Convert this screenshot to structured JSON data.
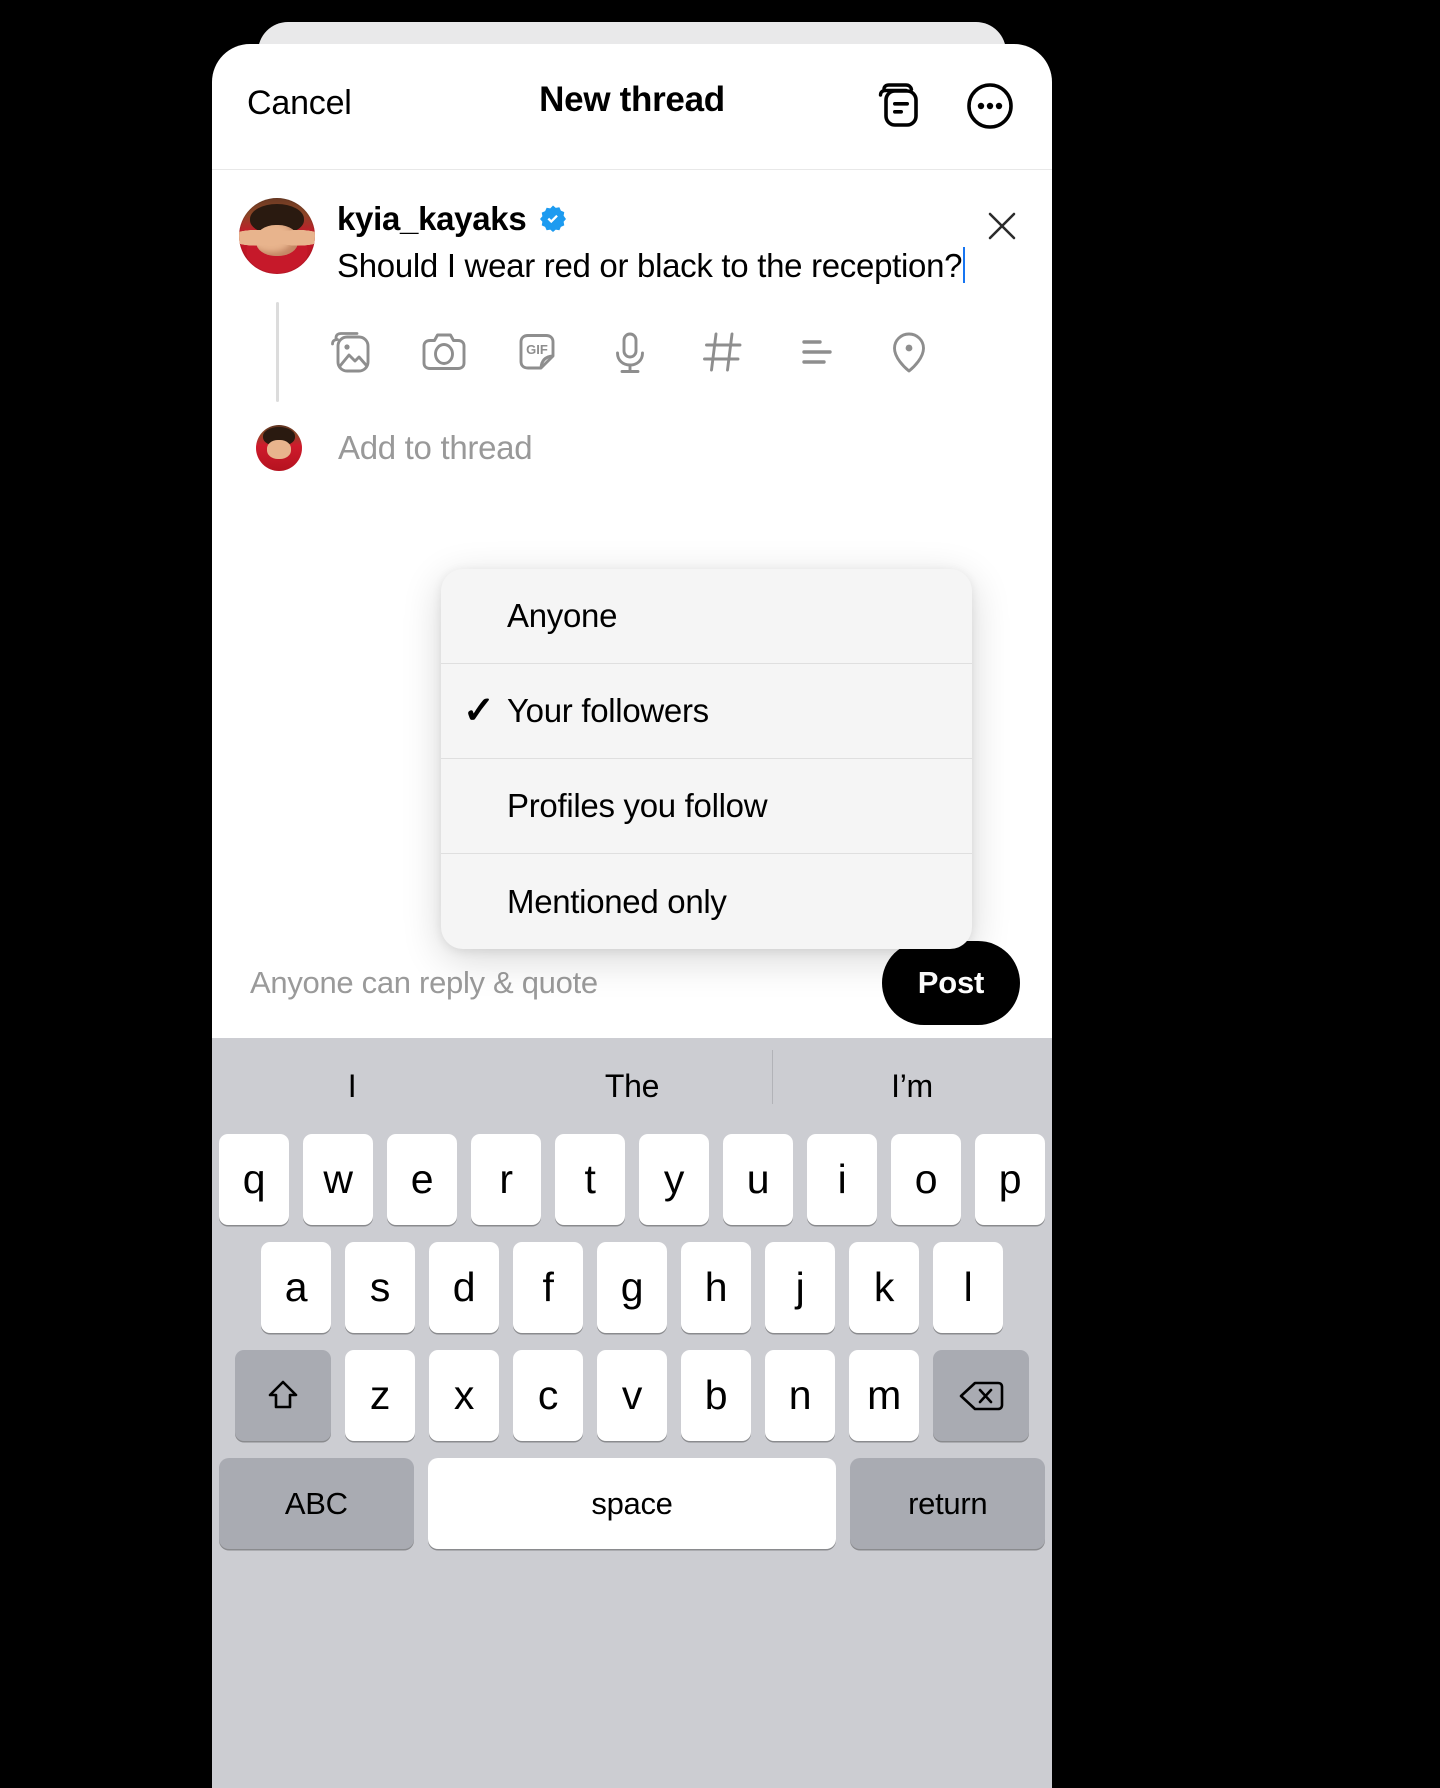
{
  "nav": {
    "cancel_label": "Cancel",
    "title": "New thread",
    "icons": [
      {
        "name": "copy-thread-icon",
        "label": "copy-thread-icon"
      },
      {
        "name": "more-options-icon",
        "label": "more-options-icon"
      }
    ]
  },
  "composer": {
    "username": "kyia_kayaks",
    "verified": true,
    "post_text": "Should I wear red or black to the reception?",
    "close_label": "×",
    "toolbar_icons": [
      "photo-icon",
      "camera-icon",
      "gif-icon",
      "microphone-icon",
      "hashtag-icon",
      "poll-icon",
      "location-icon"
    ],
    "add_to_thread_label": "Add to thread"
  },
  "audience_menu": {
    "selected": "Your followers",
    "check_glyph": "✓",
    "items": [
      {
        "label": "Anyone",
        "checked": false
      },
      {
        "label": "Your followers",
        "checked": true
      },
      {
        "label": "Profiles you follow",
        "checked": false
      },
      {
        "label": "Mentioned only",
        "checked": false
      }
    ]
  },
  "footer": {
    "reply_setting_text": "Anyone can reply & quote",
    "post_label": "Post"
  },
  "keyboard": {
    "suggestions": [
      "I",
      "The",
      "I’m"
    ],
    "row1": [
      "q",
      "w",
      "e",
      "r",
      "t",
      "y",
      "u",
      "i",
      "o",
      "p"
    ],
    "row2": [
      "a",
      "s",
      "d",
      "f",
      "g",
      "h",
      "j",
      "k",
      "l"
    ],
    "row3": [
      "z",
      "x",
      "c",
      "v",
      "b",
      "n",
      "m"
    ],
    "shift_label": "shift-icon",
    "backspace_label": "backspace-icon",
    "abc_label": "ABC",
    "space_label": "space",
    "return_label": "return"
  },
  "colors": {
    "accent_verified": "#1d9bf0",
    "post_button_bg": "#000000",
    "keyboard_bg": "#cccdd2",
    "menu_bg": "#f5f5f5",
    "muted_text": "#9a9a9a"
  }
}
